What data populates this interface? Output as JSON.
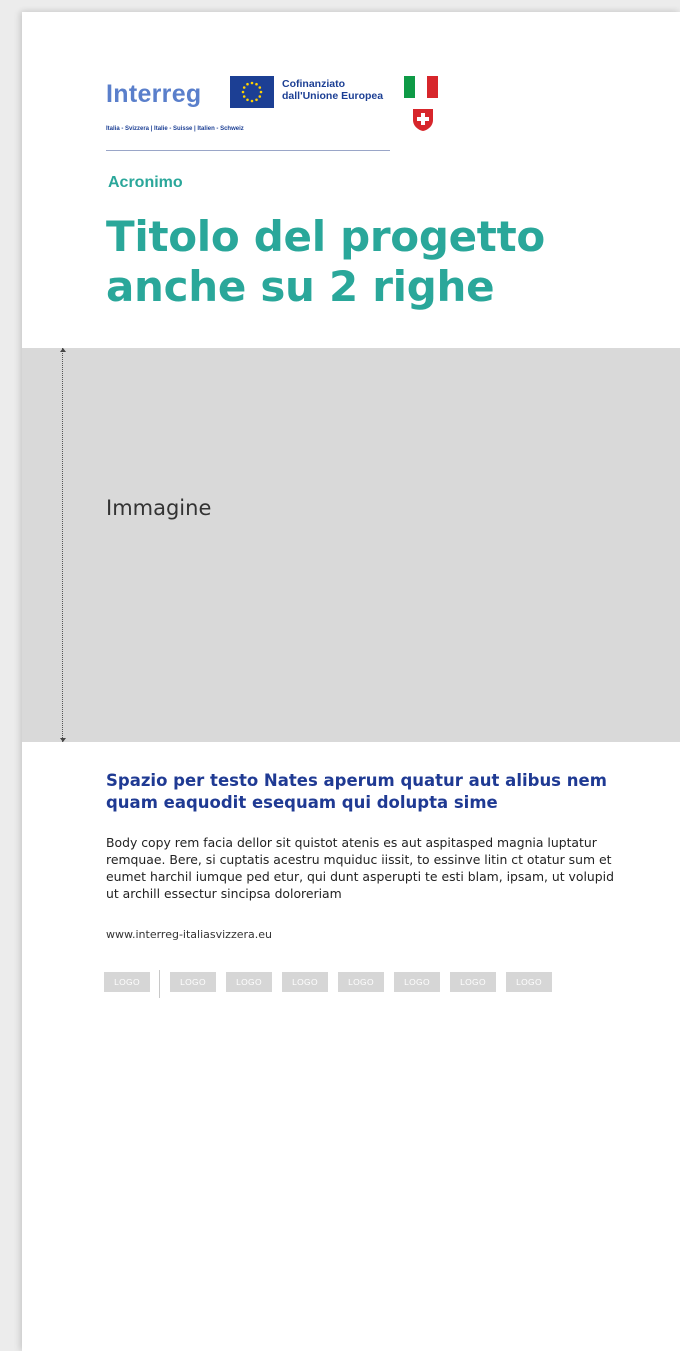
{
  "header": {
    "program_name": "Interreg",
    "cofinance_line1": "Cofinanziato",
    "cofinance_line2": "dall'Unione Europea",
    "tagline": "Italia - Svizzera | Italie - Suisse | Italien - Schweiz"
  },
  "acronym": "Acronimo",
  "title": "Titolo del progetto anche su 2 righe",
  "image_placeholder": "Immagine",
  "subtitle": "Spazio per testo Nates aperum quatur aut alibus nem quam eaquodit esequam qui dolupta sime",
  "body_copy": "Body copy rem facia dellor sit quistot atenis es aut aspitasped magnia luptatur remquae. Bere, si cuptatis acestru mquiduc iissit, to essinve litin ct otatur sum et eumet harchil iumque ped etur, qui dunt asperupti te esti blam, ipsam, ut volupid ut archill essectur sincipsa doloreriam",
  "website": "www.interreg-italiasvizzera.eu",
  "partner_logos": [
    "LOGO",
    "LOGO",
    "LOGO",
    "LOGO",
    "LOGO",
    "LOGO",
    "LOGO",
    "LOGO"
  ],
  "colors": {
    "accent_teal": "#2aa79a",
    "brand_blue": "#1f3a93",
    "interreg_blue": "#5a7fcb",
    "eu_blue": "#1c3f94",
    "placeholder_gray": "#d9d9d9"
  }
}
